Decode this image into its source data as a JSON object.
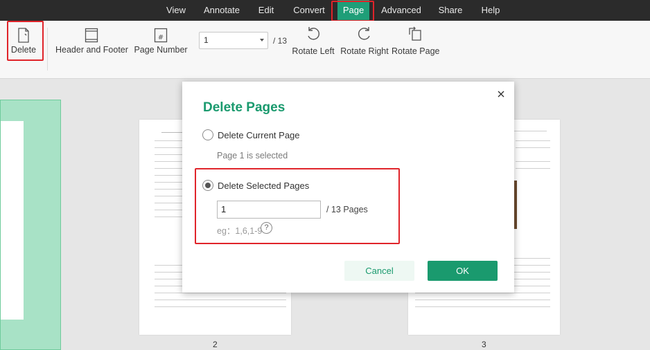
{
  "menu": {
    "items": [
      "View",
      "Annotate",
      "Edit",
      "Convert",
      "Page",
      "Advanced",
      "Share",
      "Help"
    ],
    "active": "Page"
  },
  "toolbar": {
    "delete_label": "Delete",
    "header_footer_label": "Header and Footer",
    "page_number_label": "Page Number",
    "current_page": "1",
    "total_pages": "/ 13",
    "rotate_left_label": "Rotate Left",
    "rotate_right_label": "Rotate Right",
    "rotate_page_label": "Rotate Page"
  },
  "thumbnails": {
    "page2_num": "2",
    "page3_num": "3"
  },
  "dialog": {
    "title": "Delete Pages",
    "option_current": "Delete Current Page",
    "current_hint": "Page 1 is selected",
    "option_selected": "Delete Selected Pages",
    "selected_value": "1",
    "pages_suffix": "/ 13 Pages",
    "example": "eg：1,6,1-9",
    "help": "?",
    "cancel_label": "Cancel",
    "ok_label": "OK",
    "selected_option": "Delete Selected Pages"
  },
  "colors": {
    "accent": "#1a9a6e",
    "menubar": "#2b2b2b",
    "active_tab": "#1f9e78",
    "highlight": "#e0242a"
  }
}
